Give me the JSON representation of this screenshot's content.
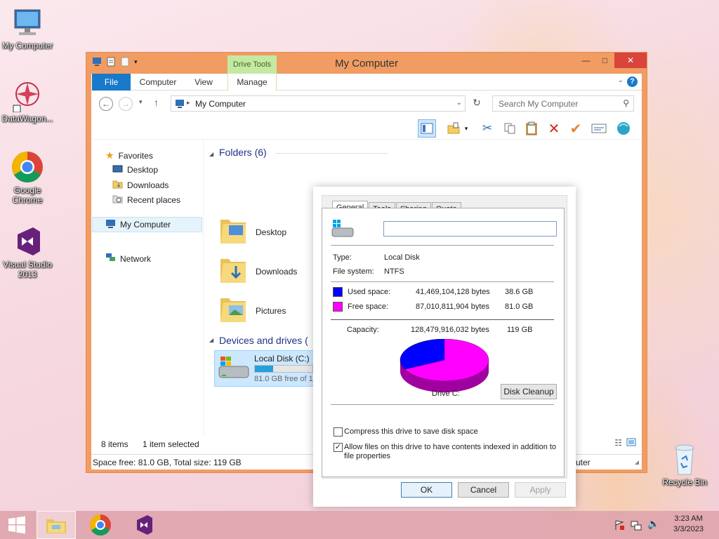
{
  "desktop": {
    "icons": [
      {
        "label": "My Computer"
      },
      {
        "label": "DataWagon..."
      },
      {
        "label": "Google Chrome"
      },
      {
        "label": "Visual Studio 2013"
      },
      {
        "label": "Recycle Bin"
      }
    ]
  },
  "window": {
    "title": "My Computer",
    "context_tab": "Drive Tools",
    "tabs": [
      "File",
      "Computer",
      "View",
      "Manage"
    ],
    "address": "My Computer",
    "search_placeholder": "Search My Computer",
    "nav": {
      "favorites": "Favorites",
      "favorites_items": [
        "Desktop",
        "Downloads",
        "Recent places"
      ],
      "computer": "My Computer",
      "network": "Network"
    },
    "folders_header": "Folders (6)",
    "folders": [
      "Desktop",
      "Downloads",
      "Pictures"
    ],
    "devices_header": "Devices and drives (",
    "drive": {
      "name": "Local Disk (C:)",
      "free_text": "81.0 GB free of 1",
      "used_fraction": 0.32
    },
    "status": {
      "items": "8 items",
      "selected": "1 item selected"
    },
    "info": {
      "space": "Space free: 81.0 GB, Total size: 119 GB",
      "right": "uter"
    }
  },
  "dialog": {
    "tabs": [
      "General",
      "Tools",
      "Sharing",
      "Quota"
    ],
    "name_value": "",
    "type_label": "Type:",
    "type_value": "Local Disk",
    "fs_label": "File system:",
    "fs_value": "NTFS",
    "used_label": "Used space:",
    "used_bytes": "41,469,104,128 bytes",
    "used_gb": "38.6 GB",
    "free_label": "Free space:",
    "free_bytes": "87,010,811,904 bytes",
    "free_gb": "81.0 GB",
    "capacity_label": "Capacity:",
    "capacity_bytes": "128,479,916,032 bytes",
    "capacity_gb": "119 GB",
    "drive_label": "Drive C:",
    "cleanup_button": "Disk Cleanup",
    "compress_label": "Compress this drive to save disk space",
    "index_label": "Allow files on this drive to have contents indexed in addition to file properties",
    "compress_checked": false,
    "index_checked": true,
    "ok": "OK",
    "cancel": "Cancel",
    "apply": "Apply",
    "used_fraction": 0.323,
    "colors": {
      "used": "#0000ff",
      "free": "#ff00ff"
    }
  },
  "taskbar": {
    "time": "3:23 AM",
    "date": "3/3/2023",
    "apps": [
      "start-icon",
      "file-explorer-icon",
      "chrome-icon",
      "visual-studio-icon"
    ]
  }
}
